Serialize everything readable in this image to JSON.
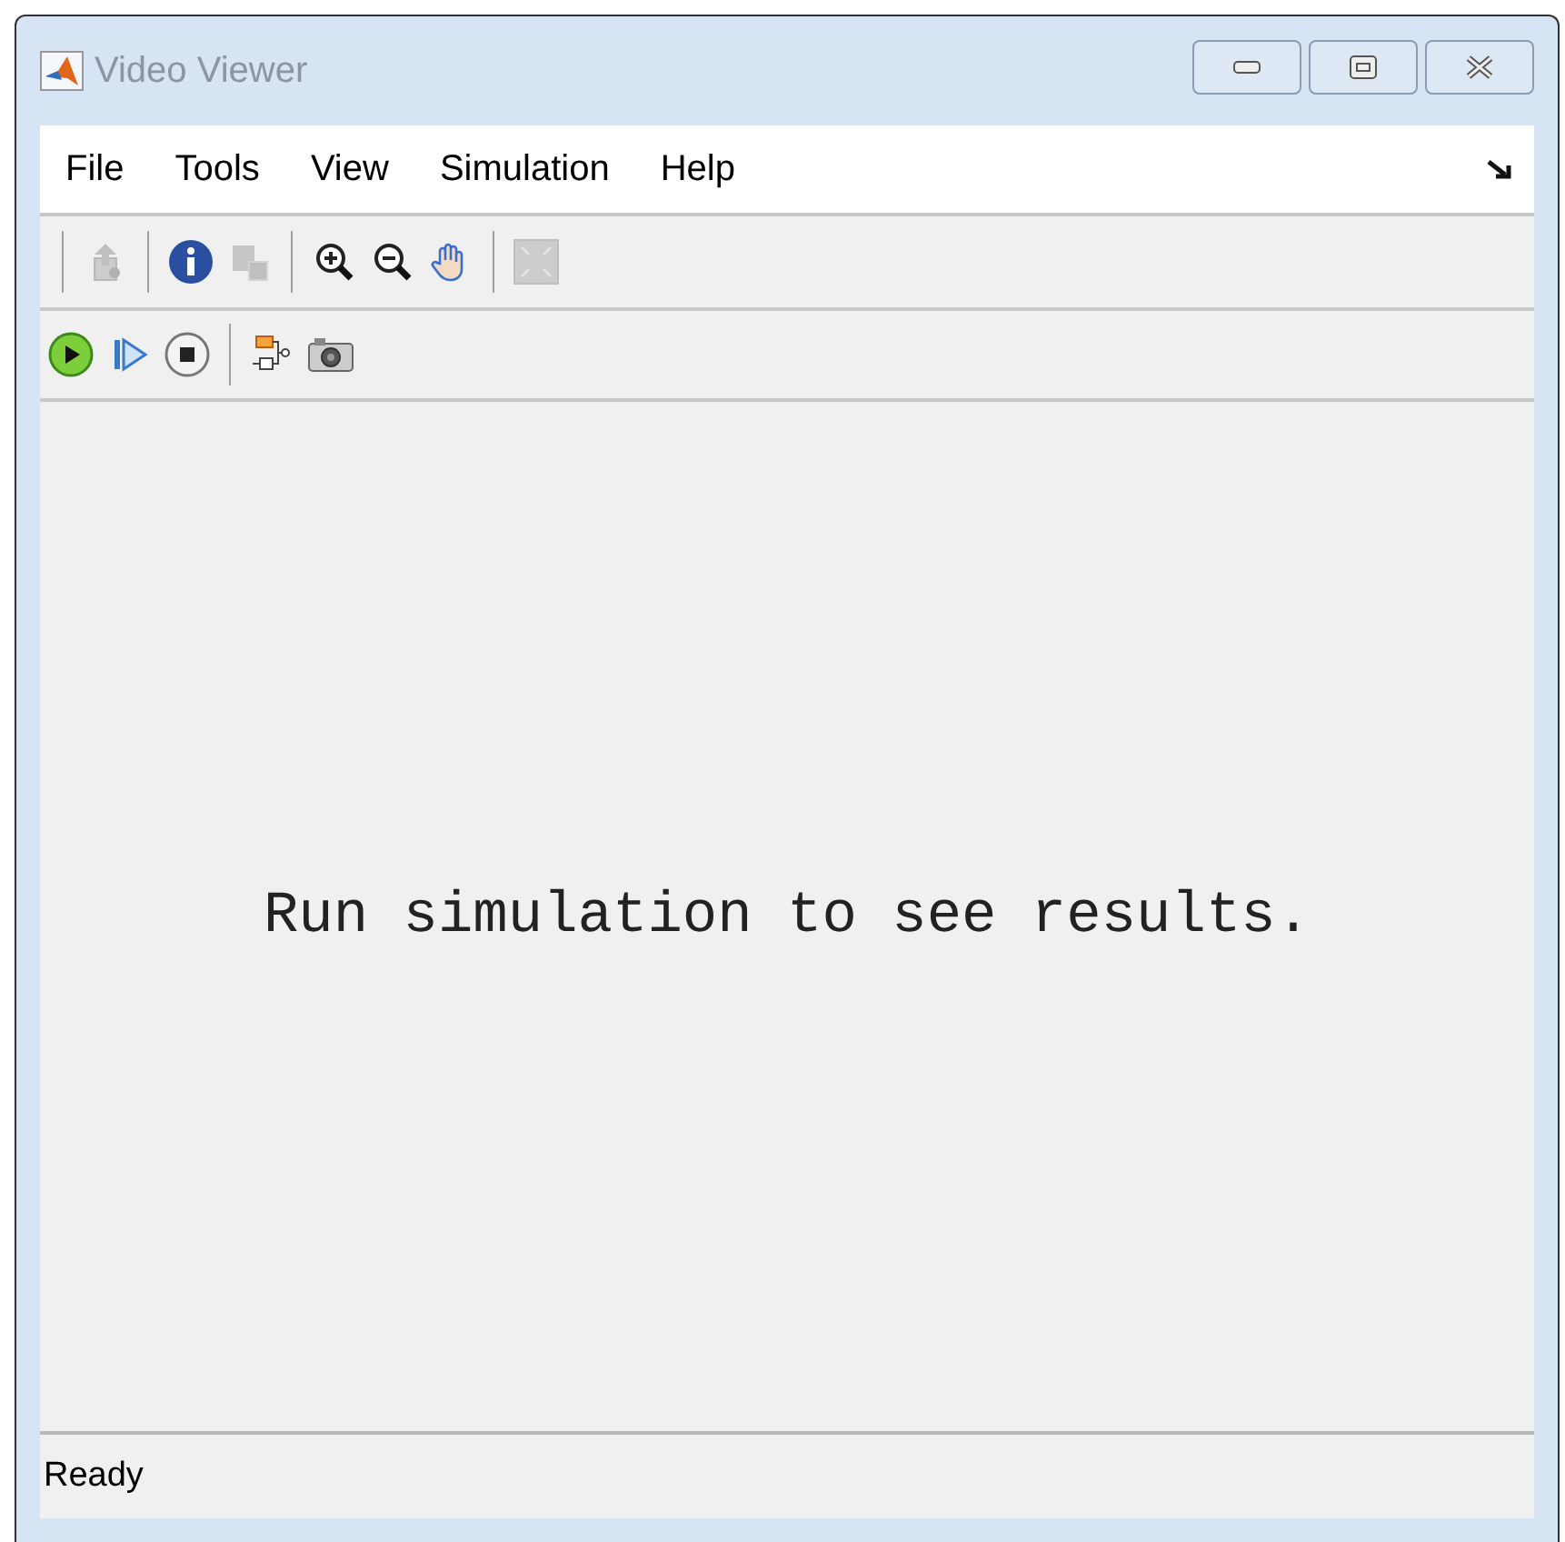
{
  "window": {
    "title": "Video Viewer"
  },
  "menu": [
    "File",
    "Tools",
    "View",
    "Simulation",
    "Help"
  ],
  "toolbar_1": [
    {
      "disabled": true
    },
    {
      "disabled": false
    },
    {
      "disabled": true
    },
    {
      "disabled": false
    },
    {
      "disabled": false
    },
    {
      "disabled": false
    },
    {
      "disabled": true
    }
  ],
  "toolbar_2": [
    {
      "disabled": false
    },
    {
      "disabled": false
    },
    {
      "disabled": false
    },
    {
      "disabled": false
    },
    {
      "disabled": false
    }
  ],
  "message": "Run simulation to see results.",
  "status_bar": "Ready"
}
